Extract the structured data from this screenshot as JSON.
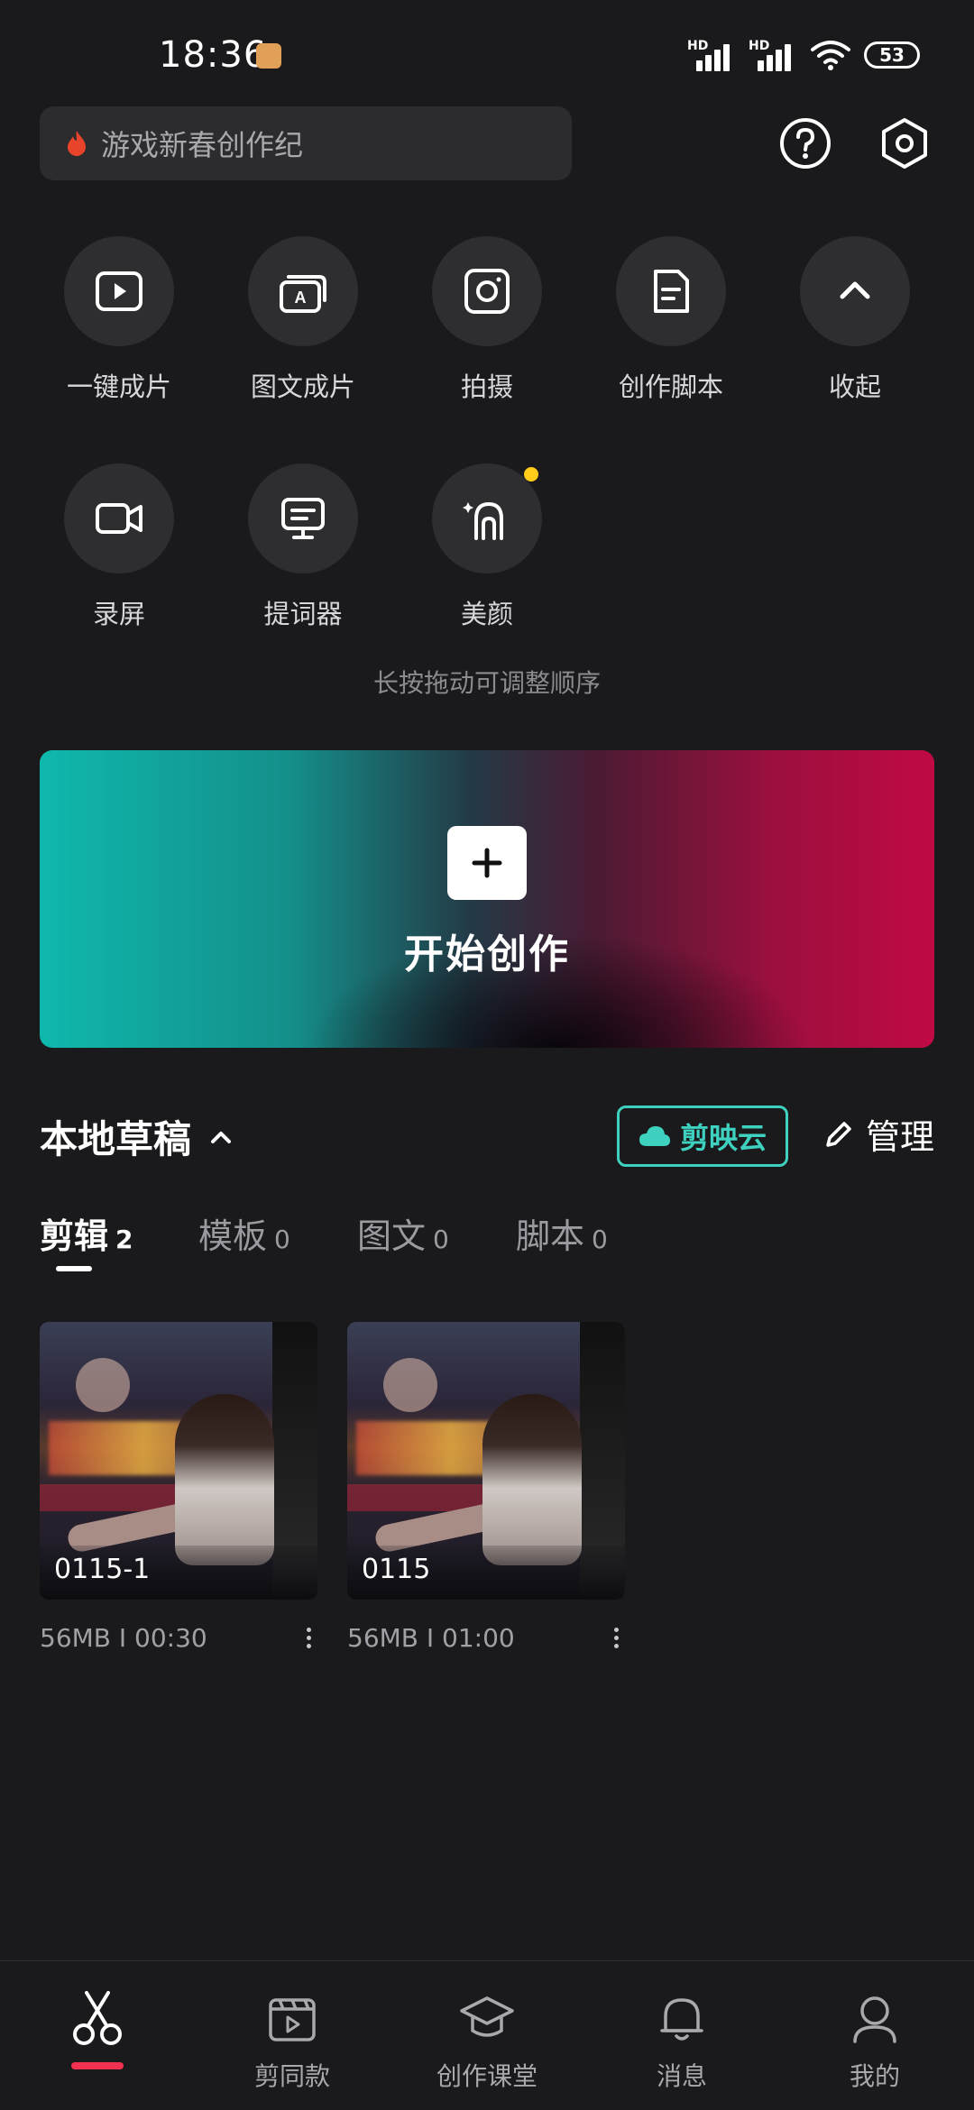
{
  "status_bar": {
    "time": "18:36",
    "signal1_label": "HD",
    "signal2_label": "HD",
    "battery": "53"
  },
  "search": {
    "placeholder": "游戏新春创作纪",
    "flame_color": "#e8432b"
  },
  "tools": [
    {
      "label": "一键成片",
      "icon": "play-square-icon"
    },
    {
      "label": "图文成片",
      "icon": "stacked-text-card-icon"
    },
    {
      "label": "拍摄",
      "icon": "camera-icon"
    },
    {
      "label": "创作脚本",
      "icon": "script-document-icon"
    },
    {
      "label": "收起",
      "icon": "chevron-up-icon"
    },
    {
      "label": "录屏",
      "icon": "video-record-icon"
    },
    {
      "label": "提词器",
      "icon": "teleprompter-icon"
    },
    {
      "label": "美颜",
      "icon": "beauty-face-icon",
      "has_badge": true
    }
  ],
  "hint": "长按拖动可调整顺序",
  "create": {
    "title": "开始创作"
  },
  "drafts": {
    "title": "本地草稿",
    "cloud_button": "剪映云",
    "manage_button": "管理",
    "tabs": [
      {
        "label": "剪辑",
        "count": "2",
        "active": true
      },
      {
        "label": "模板",
        "count": "0"
      },
      {
        "label": "图文",
        "count": "0"
      },
      {
        "label": "脚本",
        "count": "0"
      }
    ],
    "items": [
      {
        "name": "0115-1",
        "meta": "56MB Ι 00:30"
      },
      {
        "name": "0115",
        "meta": "56MB Ι 01:00"
      }
    ]
  },
  "nav": {
    "items": [
      {
        "label": "",
        "icon": "scissors-icon",
        "active": true
      },
      {
        "label": "剪同款",
        "icon": "template-clapper-icon"
      },
      {
        "label": "创作课堂",
        "icon": "graduation-cap-icon"
      },
      {
        "label": "消息",
        "icon": "bell-icon"
      },
      {
        "label": "我的",
        "icon": "profile-icon"
      }
    ]
  },
  "colors": {
    "background": "#1a1a1c",
    "accent_teal": "#3fd1bf",
    "accent_red": "#f0314f",
    "badge_yellow": "#ffcc1a"
  }
}
